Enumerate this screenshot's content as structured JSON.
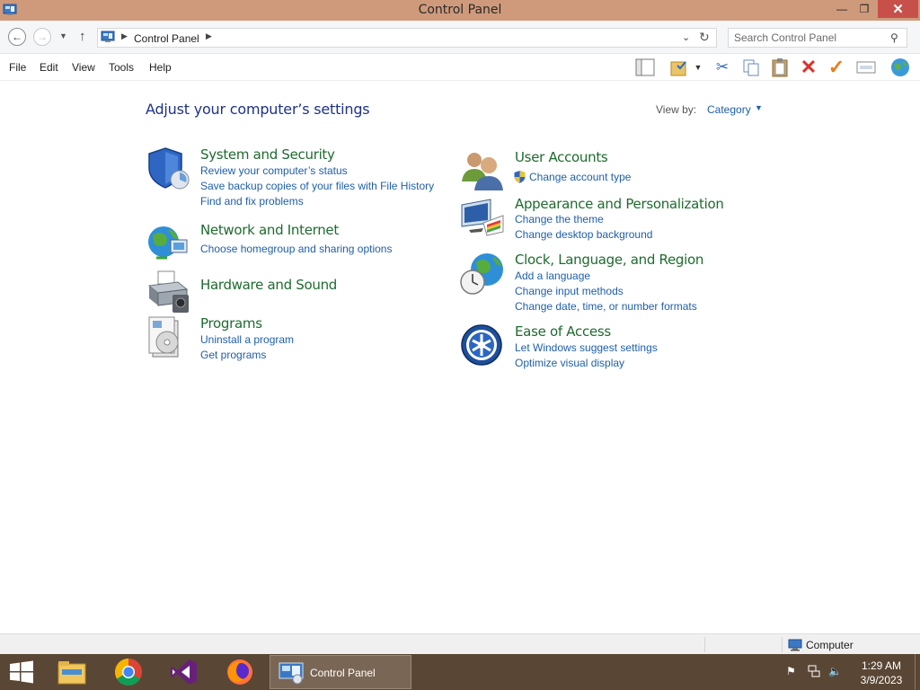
{
  "window": {
    "title": "Control Panel"
  },
  "address": {
    "crumb": "Control Panel",
    "search_placeholder": "Search Control Panel"
  },
  "menu": [
    "File",
    "Edit",
    "View",
    "Tools",
    "Help"
  ],
  "content": {
    "heading": "Adjust your computer’s settings",
    "view_by_label": "View by:",
    "view_by_value": "Category",
    "categories": [
      {
        "title": "System and Security",
        "links": [
          "Review your computer’s status",
          "Save backup copies of your files with File History",
          "Find and fix problems"
        ]
      },
      {
        "title": "Network and Internet",
        "links": [
          "Choose homegroup and sharing options"
        ]
      },
      {
        "title": "Hardware and Sound",
        "links": []
      },
      {
        "title": "Programs",
        "links": [
          "Uninstall a program",
          "Get programs"
        ]
      },
      {
        "title": "User Accounts",
        "links": [
          "Change account type"
        ]
      },
      {
        "title": "Appearance and Personalization",
        "links": [
          "Change the theme",
          "Change desktop background"
        ]
      },
      {
        "title": "Clock, Language, and Region",
        "links": [
          "Add a language",
          "Change input methods",
          "Change date, time, or number formats"
        ]
      },
      {
        "title": "Ease of Access",
        "links": [
          "Let Windows suggest settings",
          "Optimize visual display"
        ]
      }
    ]
  },
  "statusbar": {
    "location": "Computer"
  },
  "taskbar": {
    "active_task": "Control Panel",
    "time": "1:29 AM",
    "date": "3/9/2023"
  },
  "colors": {
    "titlebar": "#cf9a7c",
    "close_button": "#c7504a",
    "link": "#1f5fa8",
    "category_title": "#1e6b2f",
    "heading": "#1e3287",
    "taskbar": "#5a4634"
  }
}
